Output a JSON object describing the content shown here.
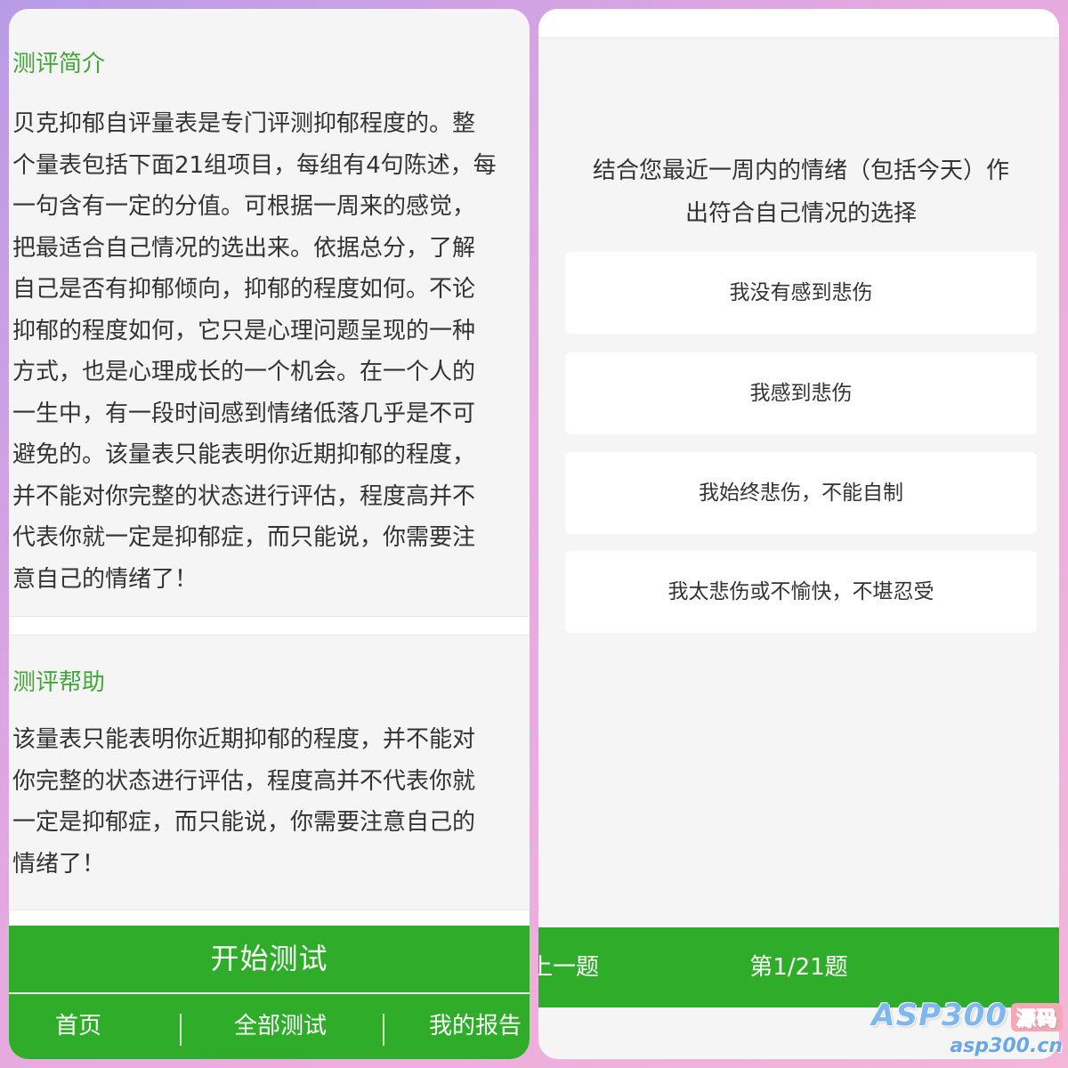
{
  "left_panel": {
    "intro": {
      "title": "测评简介",
      "lines": [
        "贝克抑郁自评量表是专门评测抑郁程度的。整",
        "个量表包括下面21组项目，每组有4句陈述，每",
        "一句含有一定的分值。可根据一周来的感觉，",
        "把最适合自己情况的选出来。依据总分，了解",
        "自己是否有抑郁倾向，抑郁的程度如何。不论",
        "抑郁的程度如何，它只是心理问题呈现的一种",
        "方式，也是心理成长的一个机会。在一个人的",
        "一生中，有一段时间感到情绪低落几乎是不可",
        "避免的。该量表只能表明你近期抑郁的程度，",
        "并不能对你完整的状态进行评估，程度高并不",
        "代表你就一定是抑郁症，而只能说，你需要注",
        "意自己的情绪了！"
      ]
    },
    "help": {
      "title": "测评帮助",
      "lines": [
        "该量表只能表明你近期抑郁的程度，并不能对",
        "你完整的状态进行评估，程度高并不代表你就",
        "一定是抑郁症，而只能说，你需要注意自己的",
        "情绪了！"
      ]
    },
    "start_button": "开始测试",
    "tabs": [
      "首页",
      "全部测试",
      "我的报告"
    ]
  },
  "right_panel": {
    "question_lines": [
      "结合您最近一周内的情绪（包括今天）作",
      "出符合自己情况的选择"
    ],
    "options": [
      "我没有感到悲伤",
      "我感到悲伤",
      "我始终悲伤，不能自制",
      "我太悲伤或不愉快，不堪忍受"
    ],
    "prev_button": "上一题",
    "progress": "第1/21题"
  },
  "watermark": {
    "brand": "ASP300",
    "tag": "源码",
    "url": "asp300.cn"
  },
  "colors": {
    "accent_green": "#2fad2a",
    "title_green": "#43a63a"
  }
}
